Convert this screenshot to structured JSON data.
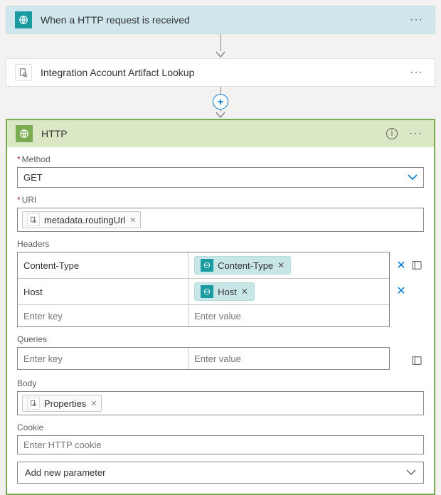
{
  "trigger": {
    "title": "When a HTTP request is received"
  },
  "lookup": {
    "title": "Integration Account Artifact Lookup"
  },
  "http": {
    "title": "HTTP",
    "methodLabel": "Method",
    "methodValue": "GET",
    "uriLabel": "URI",
    "uriToken": "metadata.routingUrl",
    "headersLabel": "Headers",
    "headers": [
      {
        "key": "Content-Type",
        "valueToken": "Content-Type"
      },
      {
        "key": "Host",
        "valueToken": "Host"
      }
    ],
    "headerKeyPlaceholder": "Enter key",
    "headerValuePlaceholder": "Enter value",
    "queriesLabel": "Queries",
    "queryKeyPlaceholder": "Enter key",
    "queryValuePlaceholder": "Enter value",
    "bodyLabel": "Body",
    "bodyToken": "Properties",
    "cookieLabel": "Cookie",
    "cookiePlaceholder": "Enter HTTP cookie",
    "addParam": "Add new parameter"
  }
}
